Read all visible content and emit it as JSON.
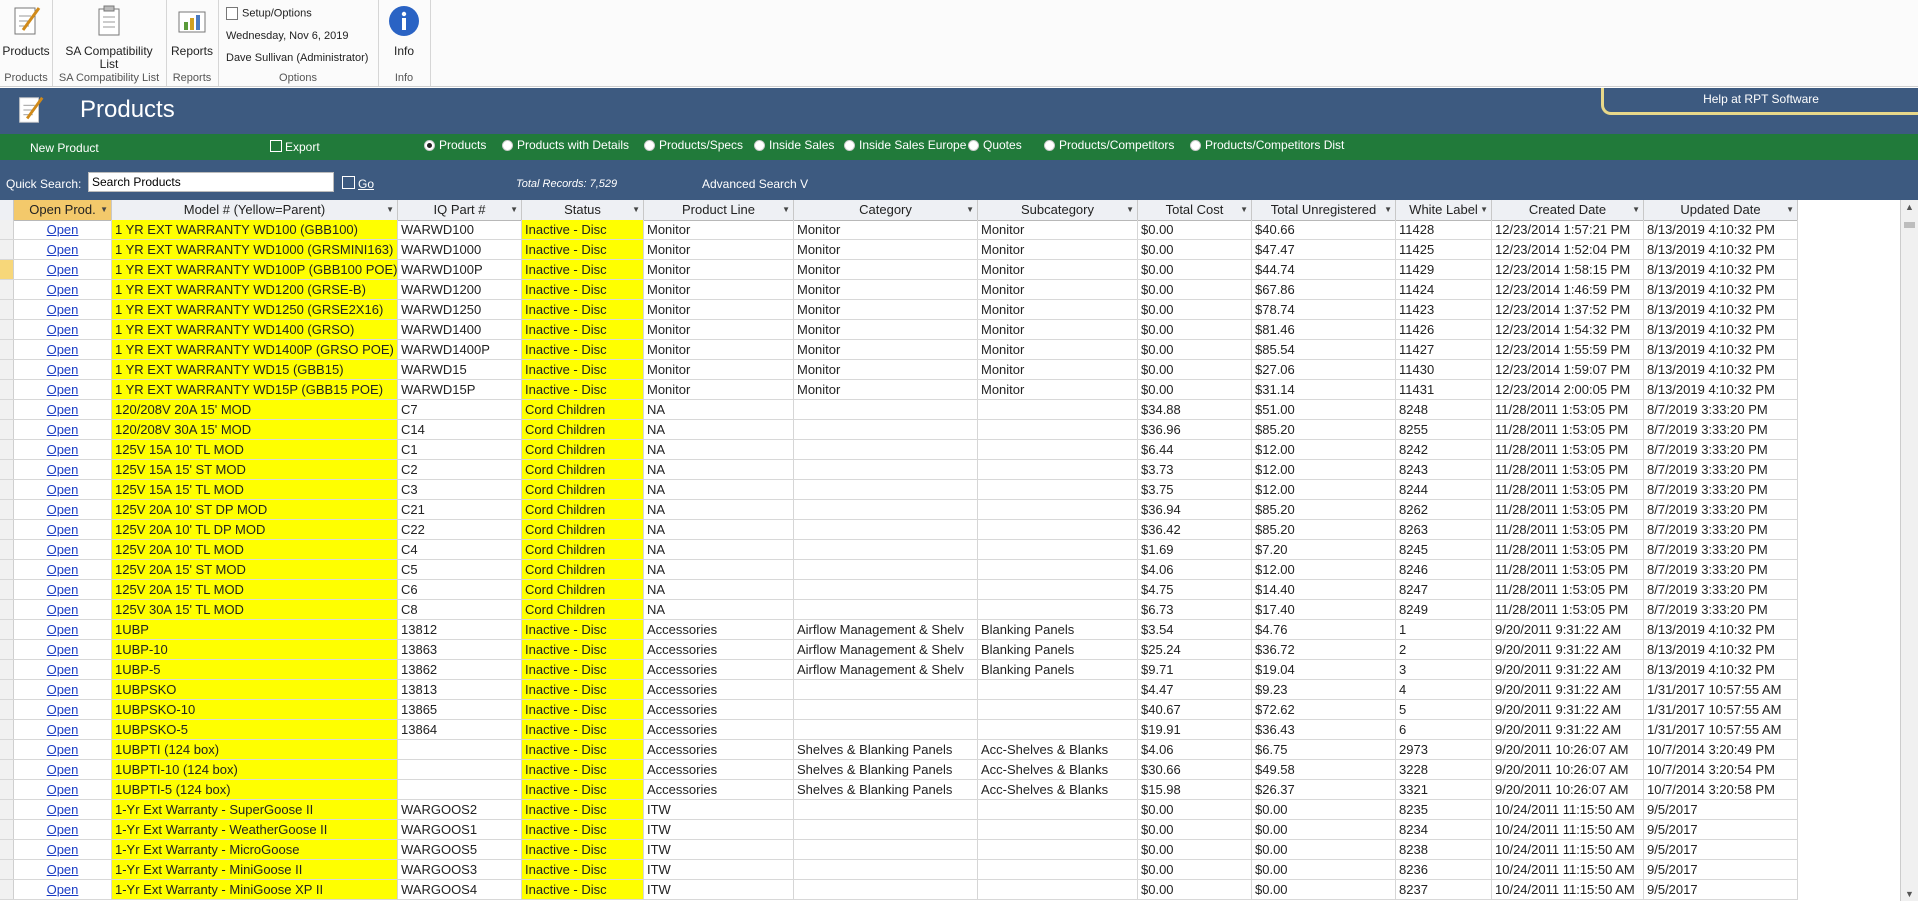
{
  "ribbon": {
    "groups": [
      {
        "label": "Products",
        "button": "Products"
      },
      {
        "label": "SA Compatibility List",
        "button": "SA Compatibility List"
      },
      {
        "label": "Reports",
        "button": "Reports"
      },
      {
        "label": "Options",
        "setup": "Setup/Options",
        "date": "Wednesday, Nov 6, 2019",
        "user": "Dave Sullivan (Administrator)"
      },
      {
        "label": "Info",
        "button": "Info"
      }
    ]
  },
  "titlebar": {
    "title": "Products",
    "help": "Help at RPT Software"
  },
  "greenbar": {
    "new_product": "New Product",
    "export": "Export",
    "views": [
      "Products",
      "Products with Details",
      "Products/Specs",
      "Inside Sales",
      "Inside Sales Europe",
      "Quotes",
      "Products/Competitors",
      "Products/Competitors Dist"
    ],
    "selected_view": "Products"
  },
  "search": {
    "label": "Quick Search:",
    "value": "Search Products",
    "go": "Go",
    "total": "Total Records: 7,529",
    "advanced": "Advanced Search V"
  },
  "table": {
    "columns": [
      "Open Prod.",
      "Model # (Yellow=Parent)",
      "IQ Part #",
      "Status",
      "Product Line",
      "Category",
      "Subcategory",
      "Total Cost",
      "Total Unregistered",
      "White Label",
      "Created Date",
      "Updated Date"
    ],
    "open_label": "Open",
    "rows": [
      [
        "1 YR EXT WARRANTY WD100 (GBB100)",
        "WARWD100",
        "Inactive - Disc",
        "Monitor",
        "Monitor",
        "Monitor",
        "$0.00",
        "$40.66",
        "11428",
        "12/23/2014 1:57:21 PM",
        "8/13/2019 4:10:32 PM"
      ],
      [
        "1 YR EXT WARRANTY WD1000 (GRSMINI163)",
        "WARWD1000",
        "Inactive - Disc",
        "Monitor",
        "Monitor",
        "Monitor",
        "$0.00",
        "$47.47",
        "11425",
        "12/23/2014 1:52:04 PM",
        "8/13/2019 4:10:32 PM"
      ],
      [
        "1 YR EXT WARRANTY WD100P (GBB100 POE)",
        "WARWD100P",
        "Inactive - Disc",
        "Monitor",
        "Monitor",
        "Monitor",
        "$0.00",
        "$44.74",
        "11429",
        "12/23/2014 1:58:15 PM",
        "8/13/2019 4:10:32 PM"
      ],
      [
        "1 YR EXT WARRANTY WD1200 (GRSE-B)",
        "WARWD1200",
        "Inactive - Disc",
        "Monitor",
        "Monitor",
        "Monitor",
        "$0.00",
        "$67.86",
        "11424",
        "12/23/2014 1:46:59 PM",
        "8/13/2019 4:10:32 PM"
      ],
      [
        "1 YR EXT WARRANTY WD1250 (GRSE2X16)",
        "WARWD1250",
        "Inactive - Disc",
        "Monitor",
        "Monitor",
        "Monitor",
        "$0.00",
        "$78.74",
        "11423",
        "12/23/2014 1:37:52 PM",
        "8/13/2019 4:10:32 PM"
      ],
      [
        "1 YR EXT WARRANTY WD1400 (GRSO)",
        "WARWD1400",
        "Inactive - Disc",
        "Monitor",
        "Monitor",
        "Monitor",
        "$0.00",
        "$81.46",
        "11426",
        "12/23/2014 1:54:32 PM",
        "8/13/2019 4:10:32 PM"
      ],
      [
        "1 YR EXT WARRANTY WD1400P (GRSO POE)",
        "WARWD1400P",
        "Inactive - Disc",
        "Monitor",
        "Monitor",
        "Monitor",
        "$0.00",
        "$85.54",
        "11427",
        "12/23/2014 1:55:59 PM",
        "8/13/2019 4:10:32 PM"
      ],
      [
        "1 YR EXT WARRANTY WD15 (GBB15)",
        "WARWD15",
        "Inactive - Disc",
        "Monitor",
        "Monitor",
        "Monitor",
        "$0.00",
        "$27.06",
        "11430",
        "12/23/2014 1:59:07 PM",
        "8/13/2019 4:10:32 PM"
      ],
      [
        "1 YR EXT WARRANTY WD15P (GBB15 POE)",
        "WARWD15P",
        "Inactive - Disc",
        "Monitor",
        "Monitor",
        "Monitor",
        "$0.00",
        "$31.14",
        "11431",
        "12/23/2014 2:00:05 PM",
        "8/13/2019 4:10:32 PM"
      ],
      [
        "120/208V 20A 15' MOD",
        "C7",
        "Cord Children",
        "NA",
        "",
        "",
        "$34.88",
        "$51.00",
        "8248",
        "11/28/2011 1:53:05 PM",
        "8/7/2019 3:33:20 PM"
      ],
      [
        "120/208V 30A 15' MOD",
        "C14",
        "Cord Children",
        "NA",
        "",
        "",
        "$36.96",
        "$85.20",
        "8255",
        "11/28/2011 1:53:05 PM",
        "8/7/2019 3:33:20 PM"
      ],
      [
        "125V 15A 10' TL MOD",
        "C1",
        "Cord Children",
        "NA",
        "",
        "",
        "$6.44",
        "$12.00",
        "8242",
        "11/28/2011 1:53:05 PM",
        "8/7/2019 3:33:20 PM"
      ],
      [
        "125V 15A 15' ST MOD",
        "C2",
        "Cord Children",
        "NA",
        "",
        "",
        "$3.73",
        "$12.00",
        "8243",
        "11/28/2011 1:53:05 PM",
        "8/7/2019 3:33:20 PM"
      ],
      [
        "125V 15A 15' TL MOD",
        "C3",
        "Cord Children",
        "NA",
        "",
        "",
        "$3.75",
        "$12.00",
        "8244",
        "11/28/2011 1:53:05 PM",
        "8/7/2019 3:33:20 PM"
      ],
      [
        "125V 20A 10' ST DP MOD",
        "C21",
        "Cord Children",
        "NA",
        "",
        "",
        "$36.94",
        "$85.20",
        "8262",
        "11/28/2011 1:53:05 PM",
        "8/7/2019 3:33:20 PM"
      ],
      [
        "125V 20A 10' TL DP MOD",
        "C22",
        "Cord Children",
        "NA",
        "",
        "",
        "$36.42",
        "$85.20",
        "8263",
        "11/28/2011 1:53:05 PM",
        "8/7/2019 3:33:20 PM"
      ],
      [
        "125V 20A 10' TL MOD",
        "C4",
        "Cord Children",
        "NA",
        "",
        "",
        "$1.69",
        "$7.20",
        "8245",
        "11/28/2011 1:53:05 PM",
        "8/7/2019 3:33:20 PM"
      ],
      [
        "125V 20A 15' ST MOD",
        "C5",
        "Cord Children",
        "NA",
        "",
        "",
        "$4.06",
        "$12.00",
        "8246",
        "11/28/2011 1:53:05 PM",
        "8/7/2019 3:33:20 PM"
      ],
      [
        "125V 20A 15' TL MOD",
        "C6",
        "Cord Children",
        "NA",
        "",
        "",
        "$4.75",
        "$14.40",
        "8247",
        "11/28/2011 1:53:05 PM",
        "8/7/2019 3:33:20 PM"
      ],
      [
        "125V 30A 15' TL MOD",
        "C8",
        "Cord Children",
        "NA",
        "",
        "",
        "$6.73",
        "$17.40",
        "8249",
        "11/28/2011 1:53:05 PM",
        "8/7/2019 3:33:20 PM"
      ],
      [
        "1UBP",
        "13812",
        "Inactive - Disc",
        "Accessories",
        "Airflow Management & Shelv",
        "Blanking Panels",
        "$3.54",
        "$4.76",
        "1",
        "9/20/2011 9:31:22 AM",
        "8/13/2019 4:10:32 PM"
      ],
      [
        "1UBP-10",
        "13863",
        "Inactive - Disc",
        "Accessories",
        "Airflow Management & Shelv",
        "Blanking Panels",
        "$25.24",
        "$36.72",
        "2",
        "9/20/2011 9:31:22 AM",
        "8/13/2019 4:10:32 PM"
      ],
      [
        "1UBP-5",
        "13862",
        "Inactive - Disc",
        "Accessories",
        "Airflow Management & Shelv",
        "Blanking Panels",
        "$9.71",
        "$19.04",
        "3",
        "9/20/2011 9:31:22 AM",
        "8/13/2019 4:10:32 PM"
      ],
      [
        "1UBPSKO",
        "13813",
        "Inactive - Disc",
        "Accessories",
        "",
        "",
        "$4.47",
        "$9.23",
        "4",
        "9/20/2011 9:31:22 AM",
        "1/31/2017 10:57:55 AM"
      ],
      [
        "1UBPSKO-10",
        "13865",
        "Inactive - Disc",
        "Accessories",
        "",
        "",
        "$40.67",
        "$72.62",
        "5",
        "9/20/2011 9:31:22 AM",
        "1/31/2017 10:57:55 AM"
      ],
      [
        "1UBPSKO-5",
        "13864",
        "Inactive - Disc",
        "Accessories",
        "",
        "",
        "$19.91",
        "$36.43",
        "6",
        "9/20/2011 9:31:22 AM",
        "1/31/2017 10:57:55 AM"
      ],
      [
        "1UBPTI (124 box)",
        "",
        "Inactive - Disc",
        "Accessories",
        "Shelves & Blanking Panels",
        "Acc-Shelves & Blanks",
        "$4.06",
        "$6.75",
        "2973",
        "9/20/2011 10:26:07 AM",
        "10/7/2014 3:20:49 PM"
      ],
      [
        "1UBPTI-10 (124 box)",
        "",
        "Inactive - Disc",
        "Accessories",
        "Shelves & Blanking Panels",
        "Acc-Shelves & Blanks",
        "$30.66",
        "$49.58",
        "3228",
        "9/20/2011 10:26:07 AM",
        "10/7/2014 3:20:54 PM"
      ],
      [
        "1UBPTI-5 (124 box)",
        "",
        "Inactive - Disc",
        "Accessories",
        "Shelves & Blanking Panels",
        "Acc-Shelves & Blanks",
        "$15.98",
        "$26.37",
        "3321",
        "9/20/2011 10:26:07 AM",
        "10/7/2014 3:20:58 PM"
      ],
      [
        "1-Yr  Ext Warranty - SuperGoose II",
        "WARGOOS2",
        "Inactive - Disc",
        "ITW",
        "",
        "",
        "$0.00",
        "$0.00",
        "8235",
        "10/24/2011 11:15:50 AM",
        "9/5/2017"
      ],
      [
        "1-Yr  Ext Warranty - WeatherGoose II",
        "WARGOOS1",
        "Inactive - Disc",
        "ITW",
        "",
        "",
        "$0.00",
        "$0.00",
        "8234",
        "10/24/2011 11:15:50 AM",
        "9/5/2017"
      ],
      [
        "1-Yr Ext Warranty - MicroGoose",
        "WARGOOS5",
        "Inactive - Disc",
        "ITW",
        "",
        "",
        "$0.00",
        "$0.00",
        "8238",
        "10/24/2011 11:15:50 AM",
        "9/5/2017"
      ],
      [
        "1-Yr Ext Warranty - MiniGoose II",
        "WARGOOS3",
        "Inactive - Disc",
        "ITW",
        "",
        "",
        "$0.00",
        "$0.00",
        "8236",
        "10/24/2011 11:15:50 AM",
        "9/5/2017"
      ],
      [
        "1-Yr Ext Warranty - MiniGoose XP II",
        "WARGOOS4",
        "Inactive - Disc",
        "ITW",
        "",
        "",
        "$0.00",
        "$0.00",
        "8237",
        "10/24/2011 11:15:50 AM",
        "9/5/2017"
      ]
    ]
  }
}
